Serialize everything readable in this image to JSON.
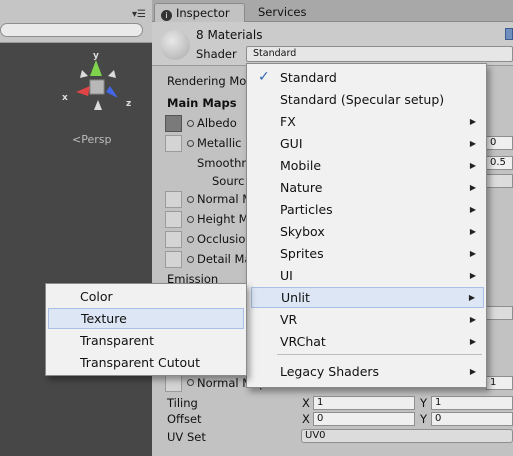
{
  "scene": {
    "persp_label": "Persp",
    "gizmo_axes": {
      "x": "x",
      "y": "y",
      "z": "z"
    },
    "menu_icon": "menu-icon"
  },
  "tabs": {
    "inspector": "Inspector",
    "services": "Services"
  },
  "header": {
    "title": "8 Materials",
    "shader_label": "Shader",
    "shader_value": "Standard"
  },
  "inspector": {
    "rendering_mode": "Rendering Mo",
    "main_maps": "Main Maps",
    "albedo": "Albedo",
    "metallic": "Metallic",
    "metallic_value": "0",
    "smoothness": "Smoothn",
    "smoothness_value": "0.5",
    "source": "Sourc",
    "normal_map": "Normal M",
    "height_map": "Height M",
    "occlusion": "Occlusio",
    "detail_mask": "Detail Ma",
    "emission": "Emission",
    "normal_map2": "Normal Map",
    "normal_map2_value": "1",
    "tiling": "Tiling",
    "offset": "Offset",
    "uv_set": "UV Set",
    "uv_set_value": "UV0",
    "x_label": "X",
    "y_label": "Y",
    "tiling_x": "1",
    "tiling_y": "1",
    "offset_x": "0",
    "offset_y": "0"
  },
  "shader_menu": {
    "items": [
      "Standard",
      "Standard (Specular setup)",
      "FX",
      "GUI",
      "Mobile",
      "Nature",
      "Particles",
      "Skybox",
      "Sprites",
      "UI",
      "Unlit",
      "VR",
      "VRChat",
      "Legacy Shaders"
    ],
    "checked": "Standard",
    "highlighted": "Unlit"
  },
  "unlit_menu": {
    "items": [
      "Color",
      "Texture",
      "Transparent",
      "Transparent Cutout"
    ],
    "highlighted": "Texture"
  },
  "colors": {
    "highlight": "#dce6f4",
    "check": "#3466b3",
    "scene_bg": "#474747"
  }
}
